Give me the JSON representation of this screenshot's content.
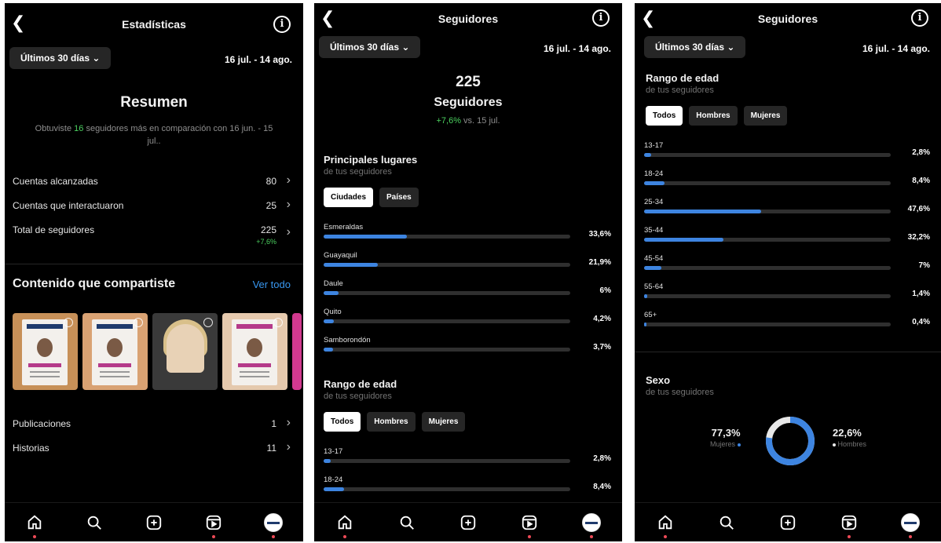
{
  "common": {
    "range_button": "Últimos 30 días",
    "date_range": "16 jul. - 14 ago.",
    "colors": {
      "accent_blue": "#3d84e0",
      "positive_green": "#4bd05f",
      "link_blue": "#3897f0"
    }
  },
  "panel1": {
    "title": "Estadísticas",
    "summary_title": "Resumen",
    "summary_text_1": "Obtuviste ",
    "summary_highlight": "16",
    "summary_text_2": " seguidores más en comparación con 16 jun. - 15 jul..",
    "stats": [
      {
        "label": "Cuentas alcanzadas",
        "value": "80"
      },
      {
        "label": "Cuentas que interactuaron",
        "value": "25"
      },
      {
        "label": "Total de seguidores",
        "value": "225",
        "sub": "+7,6%"
      }
    ],
    "content_title": "Contenido que compartiste",
    "content_link": "Ver todo",
    "rows": [
      {
        "label": "Publicaciones",
        "value": "1"
      },
      {
        "label": "Historias",
        "value": "11"
      }
    ]
  },
  "panel2": {
    "title": "Seguidores",
    "count": "225",
    "count_label": "Seguidores",
    "delta_value": "+7,6%",
    "delta_text": " vs. 15 jul.",
    "places": {
      "title": "Principales lugares",
      "subtitle": "de tus seguidores",
      "tabs": [
        "Ciudades",
        "Países"
      ],
      "items": [
        {
          "label": "Esmeraldas",
          "pct": "33,6%",
          "value": 33.6
        },
        {
          "label": "Guayaquil",
          "pct": "21,9%",
          "value": 21.9
        },
        {
          "label": "Daule",
          "pct": "6%",
          "value": 6
        },
        {
          "label": "Quito",
          "pct": "4,2%",
          "value": 4.2
        },
        {
          "label": "Samborondón",
          "pct": "3,7%",
          "value": 3.7
        }
      ]
    },
    "age": {
      "title": "Rango de edad",
      "subtitle": "de tus seguidores",
      "tabs": [
        "Todos",
        "Hombres",
        "Mujeres"
      ],
      "items": [
        {
          "label": "13-17",
          "pct": "2,8%",
          "value": 2.8
        },
        {
          "label": "18-24",
          "pct": "8,4%",
          "value": 8.4
        }
      ]
    }
  },
  "panel3": {
    "title": "Seguidores",
    "age": {
      "title": "Rango de edad",
      "subtitle": "de tus seguidores",
      "tabs": [
        "Todos",
        "Hombres",
        "Mujeres"
      ],
      "items": [
        {
          "label": "13-17",
          "pct": "2,8%",
          "value": 2.8
        },
        {
          "label": "18-24",
          "pct": "8,4%",
          "value": 8.4
        },
        {
          "label": "25-34",
          "pct": "47,6%",
          "value": 47.6
        },
        {
          "label": "35-44",
          "pct": "32,2%",
          "value": 32.2
        },
        {
          "label": "45-54",
          "pct": "7%",
          "value": 7
        },
        {
          "label": "55-64",
          "pct": "1,4%",
          "value": 1.4
        },
        {
          "label": "65+",
          "pct": "0,4%",
          "value": 0.4
        }
      ]
    },
    "sex": {
      "title": "Sexo",
      "subtitle": "de tus seguidores",
      "women_pct": "77,3%",
      "women_label": "Mujeres",
      "women_value": 77.3,
      "men_pct": "22,6%",
      "men_label": "Hombres",
      "men_value": 22.6
    }
  },
  "nav_icons": [
    "home-icon",
    "search-icon",
    "create-icon",
    "reels-icon",
    "profile-avatar"
  ]
}
